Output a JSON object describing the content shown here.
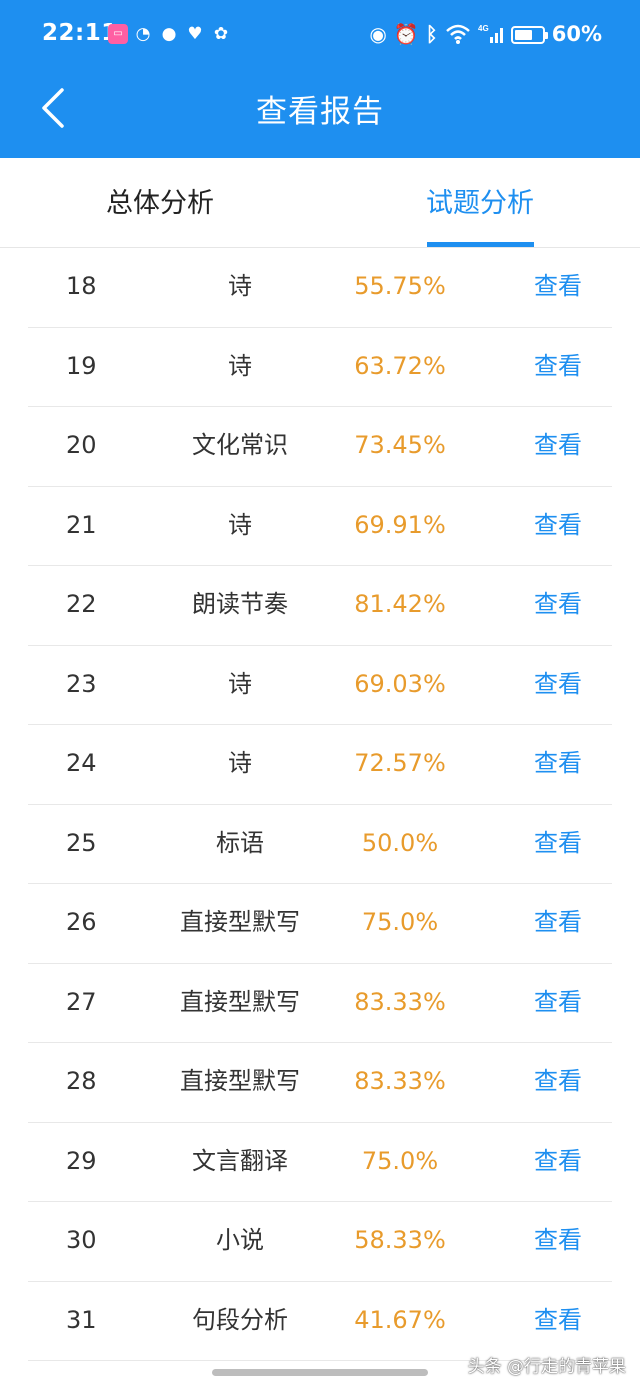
{
  "status_bar": {
    "time": "22:11",
    "battery": "60%",
    "network": "4G",
    "battery_level": 0.6
  },
  "header": {
    "title": "查看报告",
    "back_icon": "chevron-left-icon"
  },
  "tabs": [
    {
      "label": "总体分析",
      "active": false
    },
    {
      "label": "试题分析",
      "active": true
    }
  ],
  "colors": {
    "accent": "#1e8ff0",
    "rate": "#e89b2c"
  },
  "rows": [
    {
      "num": "18",
      "type": "诗",
      "rate": "55.75%",
      "action": "查看"
    },
    {
      "num": "19",
      "type": "诗",
      "rate": "63.72%",
      "action": "查看"
    },
    {
      "num": "20",
      "type": "文化常识",
      "rate": "73.45%",
      "action": "查看"
    },
    {
      "num": "21",
      "type": "诗",
      "rate": "69.91%",
      "action": "查看"
    },
    {
      "num": "22",
      "type": "朗读节奏",
      "rate": "81.42%",
      "action": "查看"
    },
    {
      "num": "23",
      "type": "诗",
      "rate": "69.03%",
      "action": "查看"
    },
    {
      "num": "24",
      "type": "诗",
      "rate": "72.57%",
      "action": "查看"
    },
    {
      "num": "25",
      "type": "标语",
      "rate": "50.0%",
      "action": "查看"
    },
    {
      "num": "26",
      "type": "直接型默写",
      "rate": "75.0%",
      "action": "查看"
    },
    {
      "num": "27",
      "type": "直接型默写",
      "rate": "83.33%",
      "action": "查看"
    },
    {
      "num": "28",
      "type": "直接型默写",
      "rate": "83.33%",
      "action": "查看"
    },
    {
      "num": "29",
      "type": "文言翻译",
      "rate": "75.0%",
      "action": "查看"
    },
    {
      "num": "30",
      "type": "小说",
      "rate": "58.33%",
      "action": "查看"
    },
    {
      "num": "31",
      "type": "句段分析",
      "rate": "41.67%",
      "action": "查看"
    }
  ],
  "watermark": "头条 @行走的青苹果"
}
